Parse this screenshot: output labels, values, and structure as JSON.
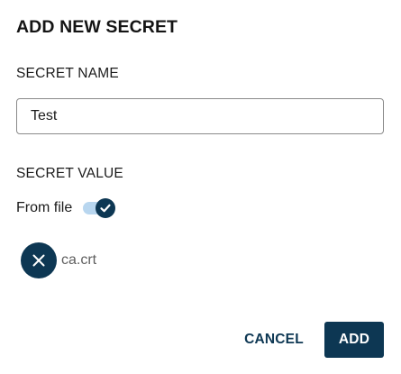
{
  "dialog": {
    "title": "ADD NEW SECRET"
  },
  "secret_name": {
    "label": "SECRET NAME",
    "value": "Test"
  },
  "secret_value": {
    "label": "SECRET VALUE",
    "from_file_label": "From file",
    "from_file_checked": true
  },
  "file": {
    "name": "ca.crt",
    "remove_icon": "close-icon"
  },
  "actions": {
    "cancel_label": "CANCEL",
    "add_label": "ADD"
  },
  "colors": {
    "primary": "#0d3753",
    "toggle_track": "#b8d6ef",
    "input_border": "#8a8a8a",
    "file_name_text": "#5f5f5f"
  }
}
